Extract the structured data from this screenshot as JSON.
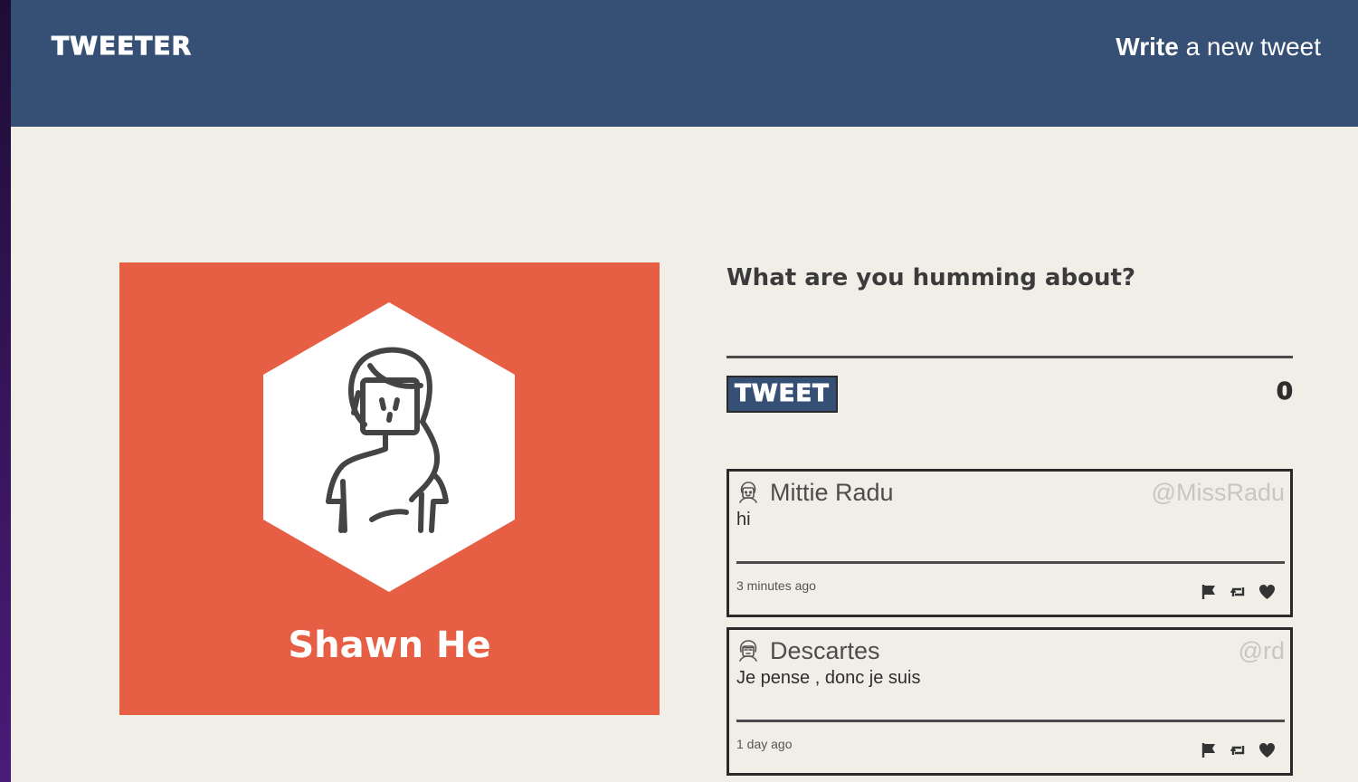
{
  "nav": {
    "brand": "TWEETER",
    "compose_bold": "Write",
    "compose_rest": " a new tweet"
  },
  "profile": {
    "name": "Shawn He",
    "color": "#e65f45"
  },
  "compose": {
    "label": "What are you humming about?",
    "textarea_value": "",
    "button_label": "TWEET",
    "counter": "0"
  },
  "tweets": [
    {
      "author": "Mittie Radu",
      "handle": "@MissRadu",
      "content": "hi",
      "time": "3 minutes ago"
    },
    {
      "author": "Descartes",
      "handle": "@rd",
      "content": "Je pense , donc je suis",
      "time": "1 day ago"
    }
  ],
  "icons": [
    "flag-icon",
    "retweet-icon",
    "heart-icon"
  ],
  "colors": {
    "nav_bg": "#364f74",
    "page_bg": "#f1eee8",
    "profile_bg": "#e65f45"
  }
}
